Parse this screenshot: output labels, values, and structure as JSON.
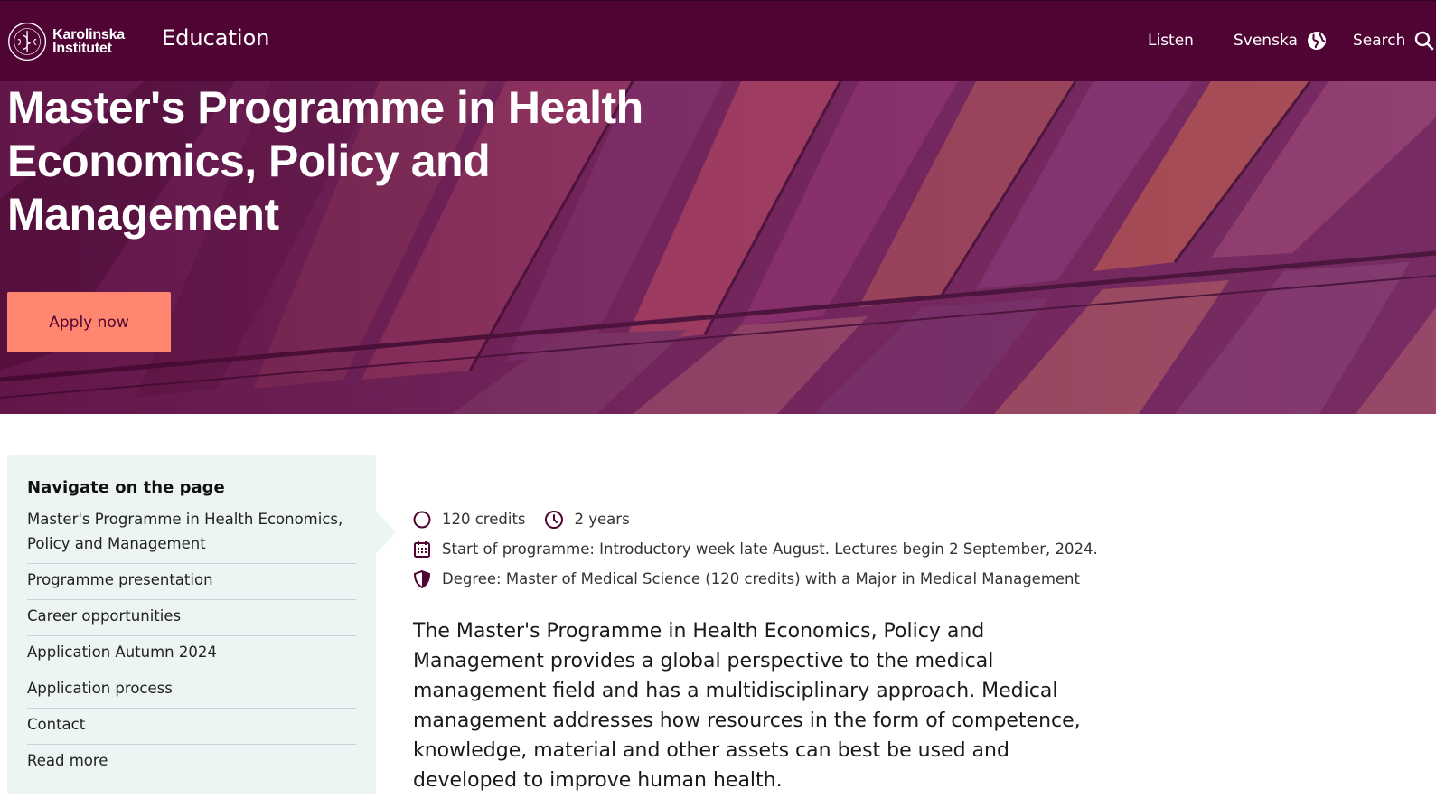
{
  "header": {
    "logo_line1": "Karolinska",
    "logo_line2": "Institutet",
    "section": "Education",
    "listen": "Listen",
    "language": "Svenska",
    "search": "Search"
  },
  "hero": {
    "title": "Master's Programme in Health Economics, Policy and Management",
    "apply_label": "Apply now"
  },
  "page_nav": {
    "heading": "Navigate on the page",
    "items": [
      "Master's Programme in Health Economics, Policy and Management",
      "Programme presentation",
      "Career opportunities",
      "Application Autumn 2024",
      "Application process",
      "Contact",
      "Read more"
    ]
  },
  "facts": {
    "credits": "120 credits",
    "duration": "2 years",
    "start": "Start of programme: Introductory week late August. Lectures begin 2 September, 2024.",
    "degree": "Degree: Master of Medical Science (120 credits) with a Major in Medical Management"
  },
  "intro": "The Master's Programme in Health Economics, Policy and Management provides a global perspective to the medical management field and has a multidisciplinary approach. Medical management addresses how resources in the form of competence, knowledge, material and other assets can best be used and developed to improve human health.",
  "colors": {
    "brand": "#4f0433",
    "accent": "#ff876f",
    "nav_bg": "#edf4f4"
  },
  "icons": [
    "ki-seal-icon",
    "globe-icon",
    "search-icon",
    "circle-icon",
    "clock-icon",
    "calendar-icon",
    "shield-icon"
  ]
}
